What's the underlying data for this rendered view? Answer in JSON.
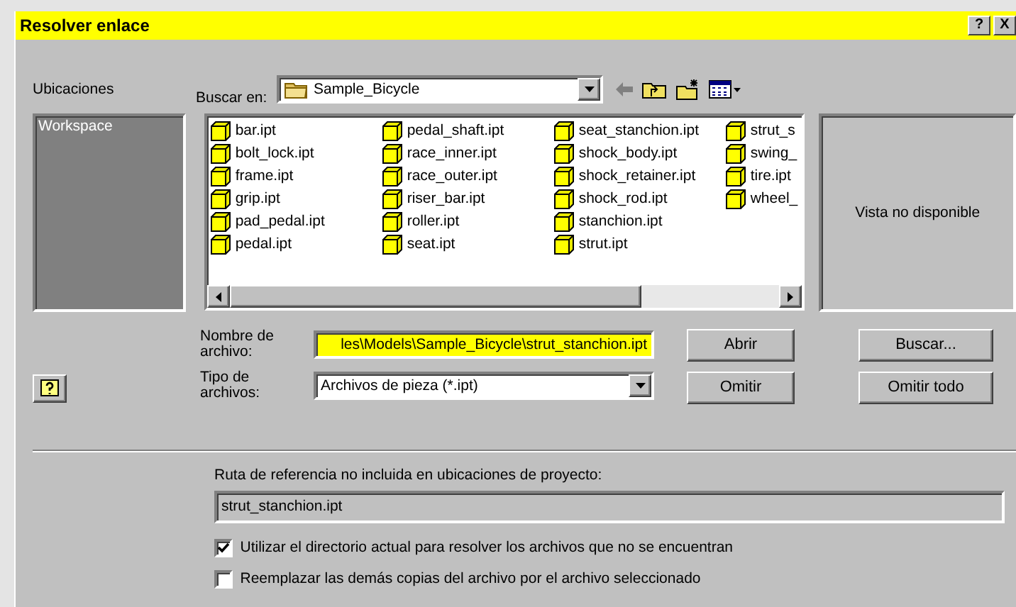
{
  "window": {
    "title": "Resolver enlace",
    "help_button": "?",
    "close_button": "X"
  },
  "locations": {
    "label": "Ubicaciones",
    "items": [
      {
        "label": "Workspace",
        "selected": false
      }
    ]
  },
  "look_in": {
    "label": "Buscar en:",
    "value": "Sample_Bicycle"
  },
  "files": [
    {
      "name": "bar.ipt"
    },
    {
      "name": "bolt_lock.ipt"
    },
    {
      "name": "frame.ipt"
    },
    {
      "name": "grip.ipt"
    },
    {
      "name": "pad_pedal.ipt"
    },
    {
      "name": "pedal.ipt"
    },
    {
      "name": "pedal_shaft.ipt"
    },
    {
      "name": "race_inner.ipt"
    },
    {
      "name": "race_outer.ipt"
    },
    {
      "name": "riser_bar.ipt"
    },
    {
      "name": "roller.ipt"
    },
    {
      "name": "seat.ipt"
    },
    {
      "name": "seat_stanchion.ipt"
    },
    {
      "name": "shock_body.ipt"
    },
    {
      "name": "shock_retainer.ipt"
    },
    {
      "name": "shock_rod.ipt"
    },
    {
      "name": "stanchion.ipt"
    },
    {
      "name": "strut.ipt"
    },
    {
      "name": "strut_s"
    },
    {
      "name": "swing_"
    },
    {
      "name": "tire.ipt"
    },
    {
      "name": "wheel_"
    }
  ],
  "preview": {
    "text": "Vista no disponible"
  },
  "file_name": {
    "label": "Nombre de archivo:",
    "value": "les\\Models\\Sample_Bicycle\\strut_stanchion.ipt"
  },
  "file_type": {
    "label": "Tipo de archivos:",
    "value": "Archivos de pieza (*.ipt)"
  },
  "buttons": [
    {
      "label": "Abrir"
    },
    {
      "label": "Omitir"
    },
    {
      "label": "Buscar..."
    },
    {
      "label": "Omitir todo"
    }
  ],
  "reference": {
    "label": "Ruta de referencia no incluida en ubicaciones de proyecto:",
    "value": "strut_stanchion.ipt"
  },
  "options": [
    {
      "label": "Utilizar el directorio actual para resolver los archivos que no se encuentran",
      "checked": true
    },
    {
      "label": "Reemplazar las demás copias del archivo por el archivo seleccionado",
      "checked": false
    }
  ]
}
